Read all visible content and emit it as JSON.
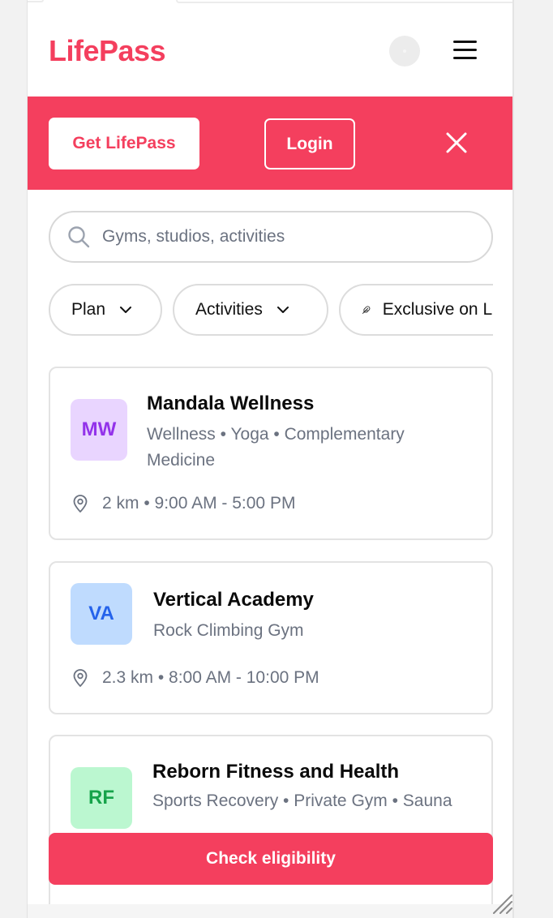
{
  "header": {
    "logo": "LifePass",
    "avatar_icon": "avatar-placeholder",
    "menu_icon": "hamburger-menu-icon"
  },
  "banner": {
    "get_label": "Get LifePass",
    "login_label": "Login",
    "close_icon": "close-icon",
    "color": "#f43f5e"
  },
  "search": {
    "placeholder": "Gyms, studios, activities",
    "value": "",
    "icon": "search-icon"
  },
  "filters": [
    {
      "label": "Plan",
      "icon": "chevron-down-icon"
    },
    {
      "label": "Activities",
      "icon": "chevron-down-icon"
    },
    {
      "label": "Exclusive on LifePass",
      "visible_label": "Exclusive or",
      "icon": "feather-icon"
    }
  ],
  "venues": [
    {
      "initials": "MW",
      "badge_bg": "#e9d5ff",
      "badge_fg": "#9333ea",
      "name": "Mandala Wellness",
      "categories": "Wellness • Yoga • Complementary Medicine",
      "meta": "2 km • 9:00 AM - 5:00 PM"
    },
    {
      "initials": "VA",
      "badge_bg": "#bfdbfe",
      "badge_fg": "#2563eb",
      "name": "Vertical Academy",
      "categories": "Rock Climbing Gym",
      "meta": "2.3 km • 8:00 AM - 10:00 PM"
    },
    {
      "initials": "RF",
      "badge_bg": "#bbf7d0",
      "badge_fg": "#16a34a",
      "name": "Reborn Fitness and Health",
      "categories": "Sports Recovery • Private Gym • Sauna",
      "meta": ""
    }
  ],
  "cta": {
    "label": "Check eligibility"
  }
}
